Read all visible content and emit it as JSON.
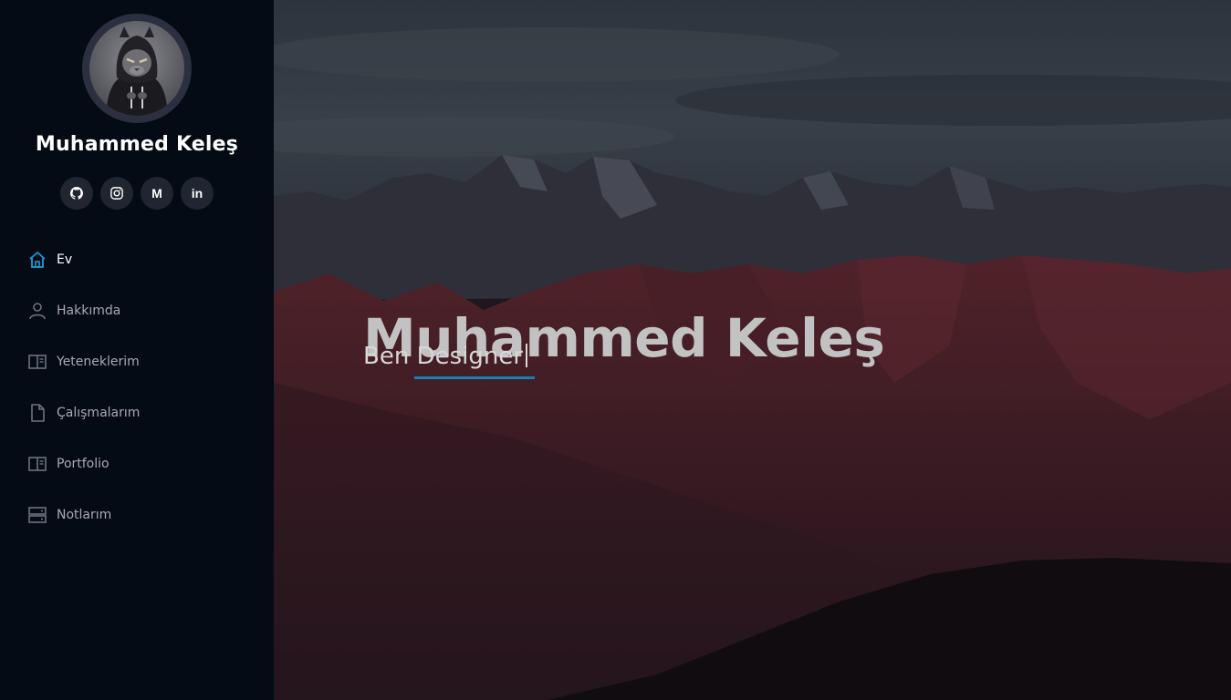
{
  "sidebar": {
    "profile_name": "Muhammed Keleş",
    "social": [
      {
        "name": "github",
        "icon": "github-icon"
      },
      {
        "name": "instagram",
        "icon": "instagram-icon"
      },
      {
        "name": "medium",
        "icon": "medium-icon",
        "glyph": "M"
      },
      {
        "name": "linkedin",
        "icon": "linkedin-icon",
        "glyph": "in"
      }
    ],
    "nav": [
      {
        "label": "Ev",
        "icon": "home-icon",
        "active": true
      },
      {
        "label": "Hakkımda",
        "icon": "person-icon",
        "active": false
      },
      {
        "label": "Yeteneklerim",
        "icon": "layout-columns-icon",
        "active": false
      },
      {
        "label": "Çalışmalarım",
        "icon": "file-icon",
        "active": false
      },
      {
        "label": "Portfolio",
        "icon": "layout-columns-icon",
        "active": false
      },
      {
        "label": "Notlarım",
        "icon": "server-icon",
        "active": false
      }
    ]
  },
  "hero": {
    "title": "Muhammed Keleş",
    "subtitle": "Ben Designer"
  },
  "colors": {
    "accent": "#149ddd",
    "sidebar_bg": "#040b14",
    "nav_text": "#a8a9b4",
    "social_bg": "#212431"
  }
}
